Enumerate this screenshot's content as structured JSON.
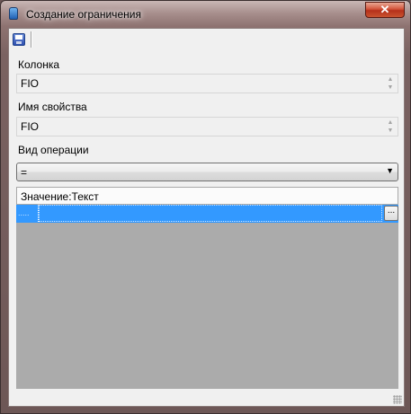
{
  "window": {
    "title": "Создание ограничения",
    "close_label": "✕"
  },
  "toolbar": {
    "save_icon": "save-icon"
  },
  "column": {
    "label": "Колонка",
    "value": "FIO"
  },
  "property": {
    "label": "Имя свойства",
    "value": "FIO"
  },
  "operation": {
    "label": "Вид операции",
    "value": "="
  },
  "value_grid": {
    "header": "Значение:Текст",
    "rows": [
      {
        "cell": "",
        "ellipsis_label": "..."
      }
    ]
  },
  "colors": {
    "selection": "#3399ff",
    "grid_background": "#ababab",
    "client_background": "#f0f0f0",
    "close_button": "#c9522f"
  }
}
